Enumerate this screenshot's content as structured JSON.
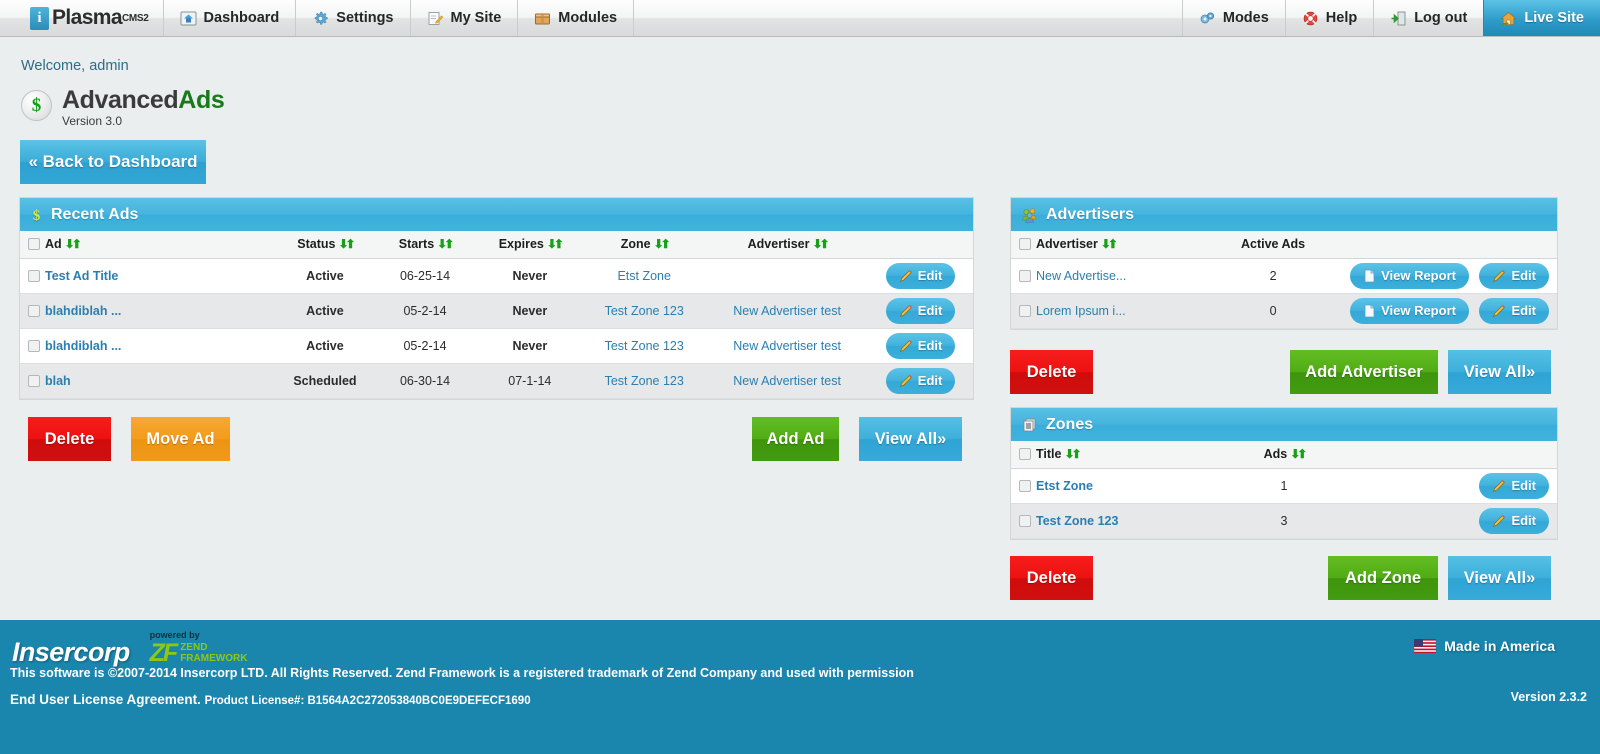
{
  "topnav": {
    "brand": {
      "name": "Plasma",
      "sup": "CMS2"
    },
    "left_items": [
      {
        "label": "Dashboard",
        "icon": "dashboard-icon"
      },
      {
        "label": "Settings",
        "icon": "gear-icon"
      },
      {
        "label": "My Site",
        "icon": "pencil-note-icon"
      },
      {
        "label": "Modules",
        "icon": "box-icon"
      }
    ],
    "right_items": [
      {
        "label": "Modes",
        "icon": "gears-icon"
      },
      {
        "label": "Help",
        "icon": "lifering-icon"
      },
      {
        "label": "Log out",
        "icon": "exit-door-icon"
      },
      {
        "label": "Live Site",
        "icon": "home-icon"
      }
    ]
  },
  "page": {
    "welcome": "Welcome, admin",
    "app_title_1": "Advanced",
    "app_title_2": "Ads",
    "version": "Version 3.0",
    "back_button": "« Back to Dashboard",
    "badge_icon": "dollar-badge-icon"
  },
  "recent_ads": {
    "title": "Recent Ads",
    "icon": "dollar-icon",
    "columns": [
      "Ad",
      "Status",
      "Starts",
      "Expires",
      "Zone",
      "Advertiser"
    ],
    "rows": [
      {
        "ad": "Test Ad Title",
        "status": "Active",
        "starts": "06-25-14",
        "expires": "Never",
        "zone": "Etst Zone",
        "advertiser": "",
        "edit": "Edit"
      },
      {
        "ad": "blahdiblah ...",
        "status": "Active",
        "starts": "05-2-14",
        "expires": "Never",
        "zone": "Test Zone 123",
        "advertiser": "New Advertiser test",
        "edit": "Edit"
      },
      {
        "ad": "blahdiblah ...",
        "status": "Active",
        "starts": "05-2-14",
        "expires": "Never",
        "zone": "Test Zone 123",
        "advertiser": "New Advertiser test",
        "edit": "Edit"
      },
      {
        "ad": "blah",
        "status": "Scheduled",
        "starts": "06-30-14",
        "expires": "07-1-14",
        "zone": "Test Zone 123",
        "advertiser": "New Advertiser test",
        "edit": "Edit"
      }
    ],
    "buttons": {
      "delete": "Delete",
      "move": "Move Ad",
      "add": "Add Ad",
      "view_all": "View All»"
    }
  },
  "advertisers": {
    "title": "Advertisers",
    "icon": "users-icon",
    "columns": [
      "Advertiser",
      "Active Ads"
    ],
    "rows": [
      {
        "name": "New Advertise...",
        "active_ads": "2",
        "report": "View Report",
        "edit": "Edit"
      },
      {
        "name": "Lorem Ipsum i...",
        "active_ads": "0",
        "report": "View Report",
        "edit": "Edit"
      }
    ],
    "buttons": {
      "delete": "Delete",
      "add": "Add Advertiser",
      "view_all": "View All»"
    }
  },
  "zones": {
    "title": "Zones",
    "icon": "zones-icon",
    "columns": [
      "Title",
      "Ads"
    ],
    "rows": [
      {
        "title": "Etst Zone",
        "ads": "1",
        "edit": "Edit"
      },
      {
        "title": "Test Zone 123",
        "ads": "3",
        "edit": "Edit"
      }
    ],
    "buttons": {
      "delete": "Delete",
      "add": "Add Zone",
      "view_all": "View All»"
    }
  },
  "footer": {
    "company": "Insercorp",
    "powered_by": "powered by",
    "zend_mark": "ZF",
    "zend_line1": "ZEND",
    "zend_line2": "FRAMEWORK",
    "copyright": "This software is ©2007-2014 Insercorp LTD. All Rights Reserved. Zend Framework is a registered trademark of Zend Company and used with permission",
    "eula": "End User License Agreement.",
    "license": "Product License#: B1564A2C272053840BC0E9DEFECF1690",
    "made_in": "Made in America",
    "version": "Version 2.3.2"
  },
  "colors": {
    "accent_blue": "#41b2dd",
    "footer_teal": "#1a86ae",
    "green": "#429b10",
    "red": "#d00c0c",
    "orange": "#f09a1a",
    "link_blue": "#2a7fb0",
    "status_active": "#138013",
    "status_scheduled": "#e8940c"
  }
}
